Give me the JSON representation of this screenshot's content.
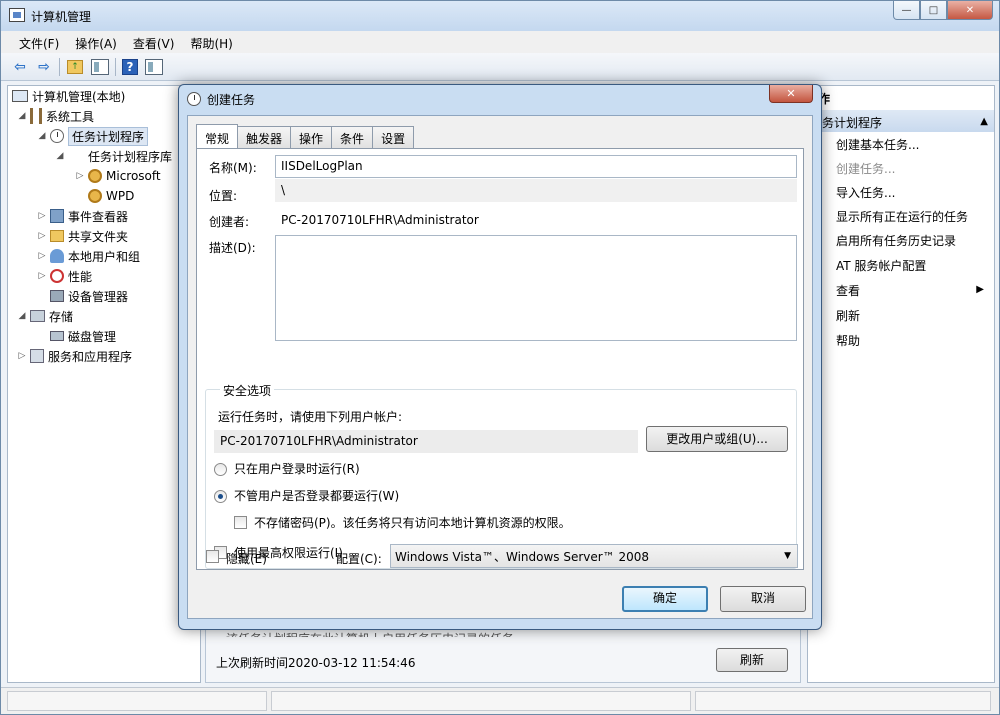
{
  "window": {
    "title": "计算机管理",
    "min": "—",
    "max": "□",
    "close": "✕"
  },
  "menu": [
    "文件(F)",
    "操作(A)",
    "查看(V)",
    "帮助(H)"
  ],
  "toolbar": {
    "back": "⇦",
    "forward": "⇨",
    "folder": "↑",
    "help": "?"
  },
  "tree": {
    "root": "计算机管理(本地)",
    "system_tools": "系统工具",
    "task_scheduler": "任务计划程序",
    "task_library": "任务计划程序库",
    "microsoft": "Microsoft",
    "wpd": "WPD",
    "event_viewer": "事件查看器",
    "shared_folders": "共享文件夹",
    "local_users": "本地用户和组",
    "performance": "性能",
    "device_manager": "设备管理器",
    "storage": "存储",
    "disk_management": "磁盘管理",
    "services_apps": "服务和应用程序"
  },
  "center": {
    "cut_text": "该任务计划程序在此计算机上启用任务历史记录的任务",
    "last_refresh": "上次刷新时间2020-03-12 11:54:46",
    "refresh": "刷新"
  },
  "actions": {
    "header": "作",
    "section": "务计划程序",
    "items": [
      "创建基本任务...",
      "创建任务...",
      "导入任务...",
      "显示所有正在运行的任务",
      "启用所有任务历史记录",
      "AT 服务帐户配置",
      "查看",
      "刷新",
      "帮助"
    ]
  },
  "dialog": {
    "title": "创建任务",
    "close": "✕",
    "tabs": [
      "常规",
      "触发器",
      "操作",
      "条件",
      "设置"
    ],
    "name_label": "名称(M):",
    "name_value": "IISDelLogPlan",
    "location_label": "位置:",
    "location_value": "\\",
    "author_label": "创建者:",
    "author_value": "PC-20170710LFHR\\Administrator",
    "desc_label": "描述(D):",
    "security_title": "安全选项",
    "run_as_text": "运行任务时，请使用下列用户帐户:",
    "user_account": "PC-20170710LFHR\\Administrator",
    "change_user_btn": "更改用户或组(U)...",
    "radio_logged_on": "只在用户登录时运行(R)",
    "radio_whether": "不管用户是否登录都要运行(W)",
    "no_store_pwd": "不存储密码(P)。该任务将只有访问本地计算机资源的权限。",
    "highest_priv": "使用最高权限运行(I)",
    "hidden": "隐藏(E)",
    "config_label": "配置(C):",
    "config_value": "Windows Vista™、Windows Server™ 2008",
    "ok": "确定",
    "cancel": "取消"
  }
}
